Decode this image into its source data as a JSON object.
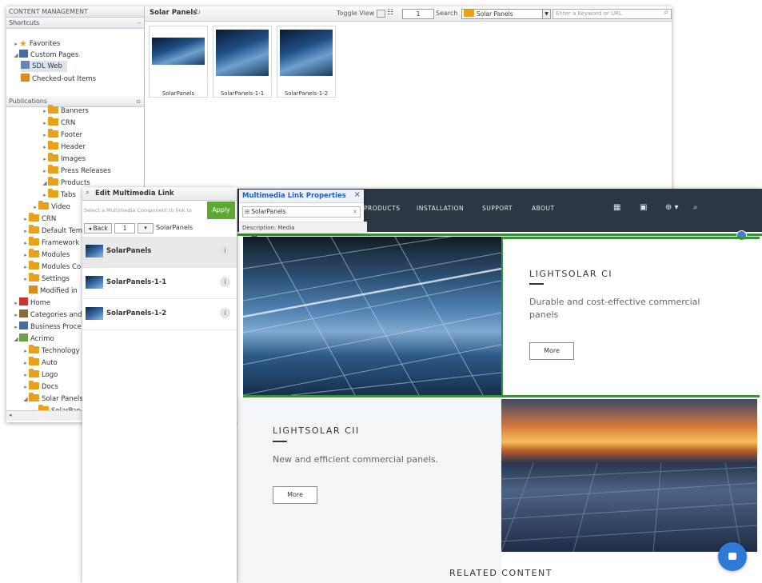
{
  "cms": {
    "title": "CONTENT MANAGEMENT",
    "shortcuts": {
      "header": "Shortcuts",
      "items": [
        {
          "label": "Favorites"
        },
        {
          "label": "Custom Pages"
        },
        {
          "label": "SDL Web"
        },
        {
          "label": "Checked-out Items"
        }
      ]
    },
    "publications": {
      "header": "Publications",
      "items": [
        {
          "label": "Banners"
        },
        {
          "label": "CRN"
        },
        {
          "label": "Footer"
        },
        {
          "label": "Header"
        },
        {
          "label": "Images"
        },
        {
          "label": "Press Releases"
        },
        {
          "label": "Products"
        },
        {
          "label": "Tabs"
        },
        {
          "label": "Video"
        },
        {
          "label": "CRN"
        },
        {
          "label": "Default Tem"
        },
        {
          "label": "Framework"
        },
        {
          "label": "Modules"
        },
        {
          "label": "Modules Co"
        },
        {
          "label": "Settings"
        },
        {
          "label": "Modified in"
        },
        {
          "label": "Home"
        },
        {
          "label": "Categories and"
        },
        {
          "label": "Business Proce"
        },
        {
          "label": "Acrimo"
        },
        {
          "label": "Technology"
        },
        {
          "label": "Auto"
        },
        {
          "label": "Logo"
        },
        {
          "label": "Docs"
        },
        {
          "label": "Solar Panels"
        },
        {
          "label": "SolarPan"
        }
      ]
    },
    "toolbar": {
      "folder": "Solar Panels",
      "toggle_view": "Toggle View",
      "page": "1",
      "search_label": "Search",
      "search_scope": "Solar Panels",
      "keyword_placeholder": "Enter a Keyword or URL"
    },
    "thumbnails": [
      {
        "caption": "SolarPanels"
      },
      {
        "caption": "SolarPanels-1-1"
      },
      {
        "caption": "SolarPanels-1-2"
      }
    ]
  },
  "edit_link": {
    "title": "Edit Multimedia Link",
    "select_placeholder": "Select a Multimedia Component to link to",
    "apply_label": "Apply",
    "back_label": "Back",
    "page": "1",
    "path": "SolarPanels",
    "items": [
      {
        "label": "SolarPanels"
      },
      {
        "label": "SolarPanels-1-1"
      },
      {
        "label": "SolarPanels-1-2"
      }
    ]
  },
  "link_props": {
    "title": "Multimedia Link Properties",
    "value": "SolarPanels",
    "description": "Description: Media"
  },
  "site": {
    "nav": {
      "links": [
        "PRODUCTS",
        "INSTALLATION",
        "SUPPORT",
        "ABOUT"
      ]
    },
    "card1": {
      "title": "LIGHTSOLAR CI",
      "text": "Durable and cost-effective commercial panels",
      "more": "More"
    },
    "card2": {
      "title": "LIGHTSOLAR CII",
      "text": "New and efficient commercial panels.",
      "more": "More"
    },
    "related": "RELATED CONTENT"
  },
  "colors": {
    "nav_bg": "#2c3744",
    "accent_green": "#3c8f3c",
    "apply_green": "#5aa832",
    "chat_blue": "#2f7ad6",
    "props_title_blue": "#1f5fbf"
  }
}
